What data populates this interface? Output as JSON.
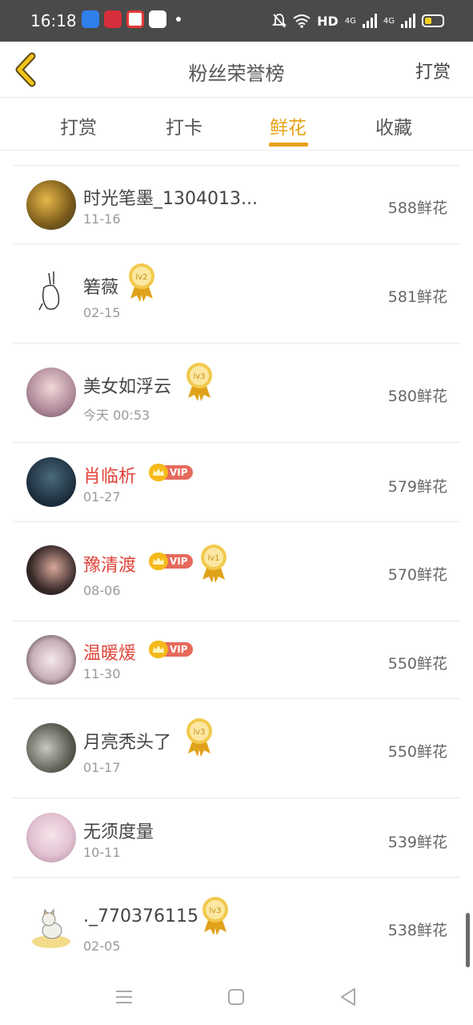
{
  "status_bar": {
    "time": "16:18",
    "network": "HD",
    "signal_1": "4G",
    "signal_2": "4G",
    "icons": [
      "bell-off-icon",
      "wifi-icon",
      "battery-icon"
    ]
  },
  "header": {
    "title": "粉丝荣誉榜",
    "action_label": "打赏",
    "back_icon": "chevron-left-icon"
  },
  "tabs": [
    {
      "label": "打赏",
      "active": false
    },
    {
      "label": "打卡",
      "active": false
    },
    {
      "label": "鲜花",
      "active": true
    },
    {
      "label": "收藏",
      "active": false
    }
  ],
  "accent_color": "#e8a117",
  "vip_color": "#e0443a",
  "fans": [
    {
      "name": "时光笔墨_1304013...",
      "date": "11-16",
      "amount": "588鲜花",
      "vip": false,
      "level": ""
    },
    {
      "name": "箬薇",
      "date": "02-15",
      "amount": "581鲜花",
      "vip": false,
      "level": "lv2"
    },
    {
      "name": "美女如浮云",
      "date": "今天 00:53",
      "amount": "580鲜花",
      "vip": false,
      "level": "lv3"
    },
    {
      "name": "肖临析",
      "date": "01-27",
      "amount": "579鲜花",
      "vip": true,
      "vip_label": "VIP",
      "level": ""
    },
    {
      "name": "豫清渡",
      "date": "08-06",
      "amount": "570鲜花",
      "vip": true,
      "vip_label": "VIP",
      "level": "lv1"
    },
    {
      "name": "温暖煖",
      "date": "11-30",
      "amount": "550鲜花",
      "vip": true,
      "vip_label": "VIP",
      "level": ""
    },
    {
      "name": "月亮秃头了",
      "date": "01-17",
      "amount": "550鲜花",
      "vip": false,
      "level": "lv3"
    },
    {
      "name": "无须度量",
      "date": "10-11",
      "amount": "539鲜花",
      "vip": false,
      "level": ""
    },
    {
      "name": "._770376115",
      "date": "02-05",
      "amount": "538鲜花",
      "vip": false,
      "level": "lv3"
    }
  ]
}
